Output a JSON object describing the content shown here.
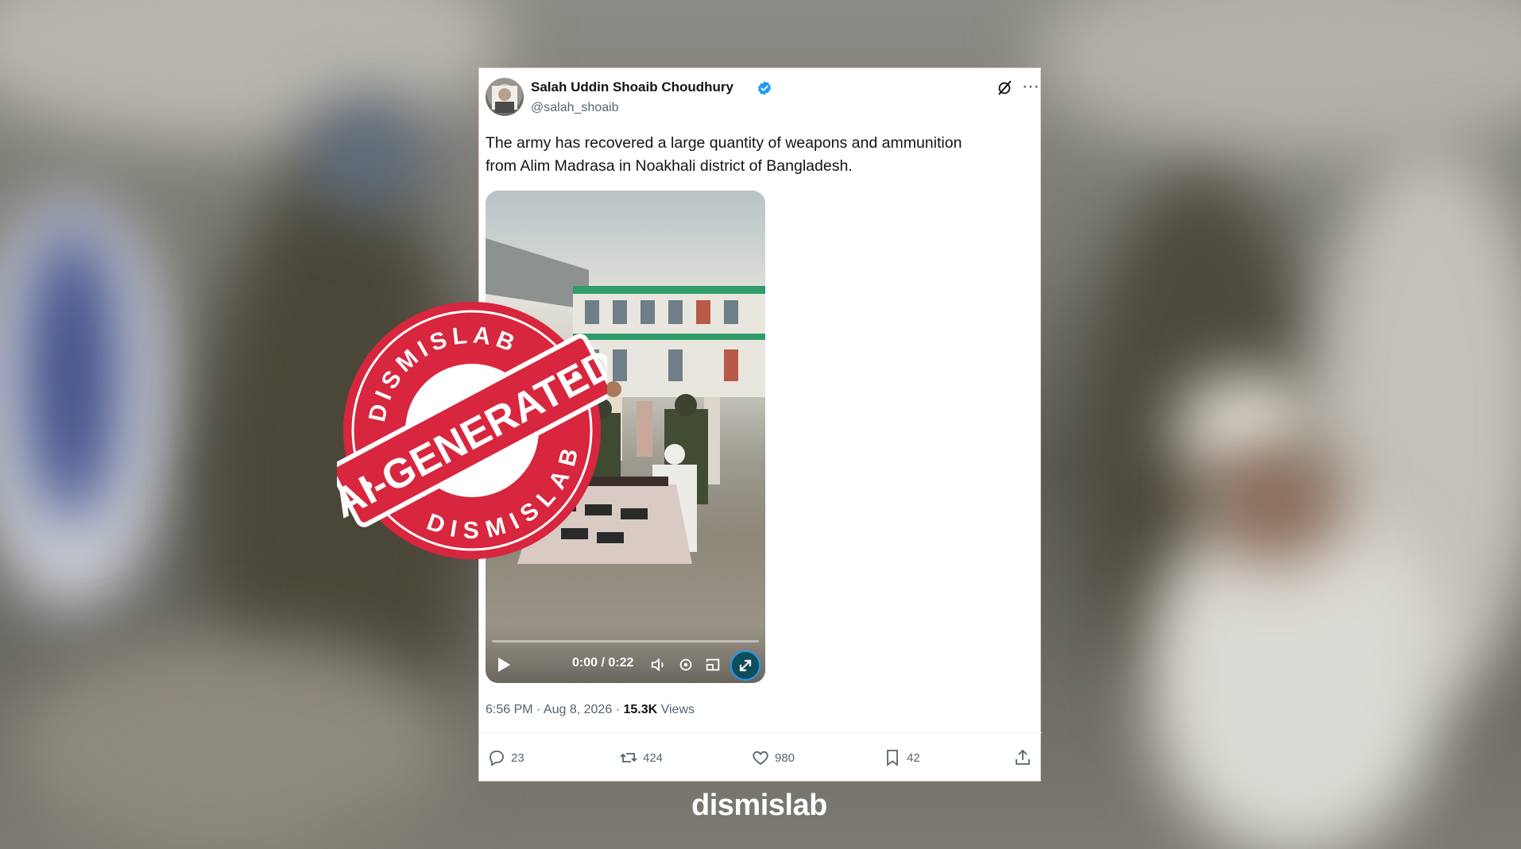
{
  "tweet": {
    "author_name": "Salah Uddin Shoaib Choudhury",
    "handle": "@salah_shoaib",
    "text_line1": "The army has recovered a large quantity of weapons and ammunition",
    "text_line2": "from Alim Madrasa in Noakhali district of Bangladesh.",
    "video_time": "0:00 / 0:22",
    "timestamp": "6:56 PM · Aug 8, 2026 ·",
    "views_count": "15.3K",
    "views_label": "Views",
    "replies": "23",
    "reposts": "424",
    "likes": "980",
    "bookmarks": "42"
  },
  "icons": [
    "verified-badge-icon",
    "grok-icon",
    "more-icon",
    "play-icon",
    "volume-icon",
    "settings-icon",
    "pip-icon",
    "expand-icon",
    "reply-icon",
    "repost-icon",
    "like-icon",
    "bookmark-icon",
    "share-icon"
  ],
  "stamp": {
    "top_text": "DISMISLAB",
    "bottom_text": "DISMISLAB",
    "label": "AI-GENERATED",
    "color": "#d7263d"
  },
  "footer": {
    "brand": "dismislab"
  },
  "colors": {
    "accent": "#1d9bf0",
    "text": "#0f1419",
    "muted": "#536471",
    "stamp": "#d7263d"
  }
}
